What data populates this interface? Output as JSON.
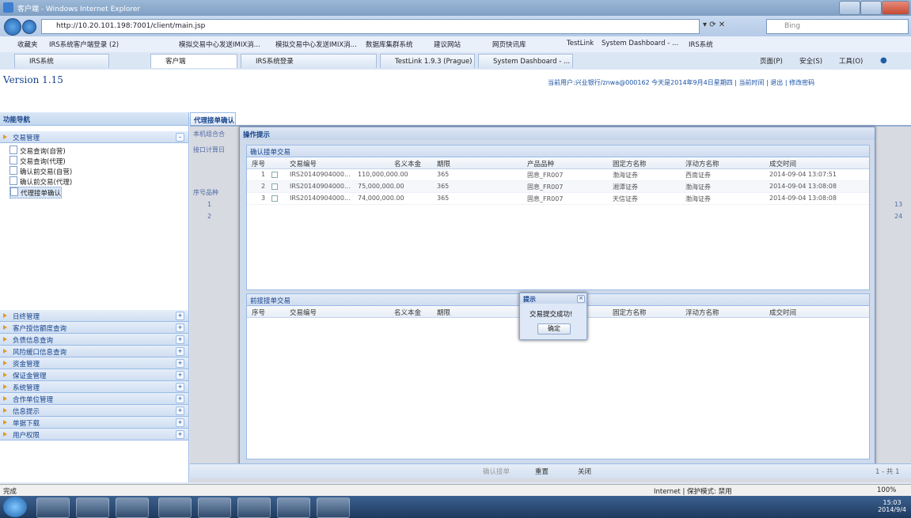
{
  "window": {
    "title": "客户端 - Windows Internet Explorer",
    "url": "http://10.20.101.198:7001/client/main.jsp",
    "search_engine": "Bing"
  },
  "favorites": [
    "收藏夹",
    "IRS系统客户端登录 (2)",
    "模拟交易中心发送IMIX消...",
    "模拟交易中心发送IMIX消...",
    "数据库集群系统",
    "建议网站",
    "网页快讯库",
    "TestLink",
    "System Dashboard - ...",
    "IRS系统"
  ],
  "ie_tabs": [
    "IRS系统",
    "客户端",
    "IRS系统登录",
    "TestLink 1.9.3 (Prague)",
    "System Dashboard - ..."
  ],
  "ie_commands": {
    "page": "页面(P)",
    "safety": "安全(S)",
    "tools": "工具(O)"
  },
  "app": {
    "version": "Version 1.15",
    "user_info": "当前用户:兴业银行/znwa@000162 今天是2014年9月4日星期四 | 当前时间 | 退出 | 修改密码"
  },
  "left_panel": {
    "title": "功能导航",
    "open_group": "交易管理",
    "tree_items": [
      "交易查询(自营)",
      "交易查询(代理)",
      "确认前交易(自营)",
      "确认前交易(代理)",
      "代理接单确认"
    ],
    "groups": [
      "日终管理",
      "客户授信额度查询",
      "负债信息查询",
      "风险缓口信息查询",
      "资金管理",
      "保证金管理",
      "系统管理",
      "合作单位管理",
      "信息提示",
      "单据下载",
      "用户权限"
    ]
  },
  "main_tab": "代理接单确认",
  "background": {
    "label1": "本机组合合",
    "label2": "接口计算日",
    "col_no": "序号",
    "col_product": "品种",
    "rows": [
      "1",
      "2"
    ],
    "right_vals": [
      "13",
      "24"
    ]
  },
  "modal": {
    "title": "操作提示",
    "upper_title": "确认接单交易",
    "lower_title": "前接接单交易",
    "headers": [
      "序号",
      "交易编号",
      "名义本金",
      "期限",
      "产品品种",
      "固定方名称",
      "浮动方名称",
      "成交时间"
    ],
    "rows": [
      {
        "no": "1",
        "id": "IRS20140904000...",
        "notional": "110,000,000.00",
        "term": "365",
        "product": "固息_FR007",
        "fixed": "渤海证券",
        "floating": "西南证券",
        "time": "2014-09-04 13:07:51"
      },
      {
        "no": "2",
        "id": "IRS20140904000...",
        "notional": "75,000,000.00",
        "term": "365",
        "product": "固息_FR007",
        "fixed": "湘潭证券",
        "floating": "渤海证券",
        "time": "2014-09-04 13:08:08"
      },
      {
        "no": "3",
        "id": "IRS20140904000...",
        "notional": "74,000,000.00",
        "term": "365",
        "product": "固息_FR007",
        "fixed": "天信证券",
        "floating": "渤海证券",
        "time": "2014-09-04 13:08:08"
      }
    ]
  },
  "alert": {
    "title": "提示",
    "message": "交易提交成功!",
    "ok": "确定"
  },
  "bottom_buttons": {
    "confirm": "确认接单",
    "reset": "重置",
    "close": "关闭",
    "page": "1 - 共 1"
  },
  "status": {
    "left": "完成",
    "zone": "Internet | 保护模式: 禁用",
    "zoom": "100%"
  },
  "clock": {
    "time": "15:03",
    "date": "2014/9/4"
  }
}
